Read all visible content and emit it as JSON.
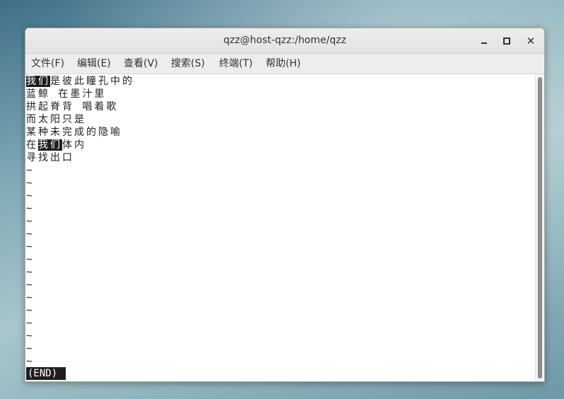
{
  "window": {
    "title": "qzz@host-qzz:/home/qzz",
    "min_icon": "minimize-icon",
    "max_icon": "maximize-icon",
    "close_icon": "close-icon",
    "close_glyph": "✕"
  },
  "menu": {
    "items": [
      "文件(F)",
      "编辑(E)",
      "查看(V)",
      "搜索(S)",
      "终端(T)",
      "帮助(H)"
    ]
  },
  "terminal": {
    "lines": [
      {
        "hl": "我们",
        "after": "是彼此瞳孔中的"
      },
      {
        "text": "蓝鲸 在墨汁里"
      },
      {
        "text": "拱起脊背 唱着歌"
      },
      {
        "text": "而太阳只是"
      },
      {
        "text": "某种未完成的隐喻"
      },
      {
        "before": "在",
        "hl": "我们",
        "after": "体内"
      },
      {
        "text": "寻找出口"
      }
    ],
    "tilde": "~",
    "tilde_count": 16,
    "status": "(END)"
  },
  "colors": {
    "terminal_bg": "#ffffff",
    "terminal_fg": "#1e1e1e",
    "highlight_bg": "#1e1e1e",
    "highlight_fg": "#ffffff",
    "titlebar_bg": "#e7e7e7"
  }
}
